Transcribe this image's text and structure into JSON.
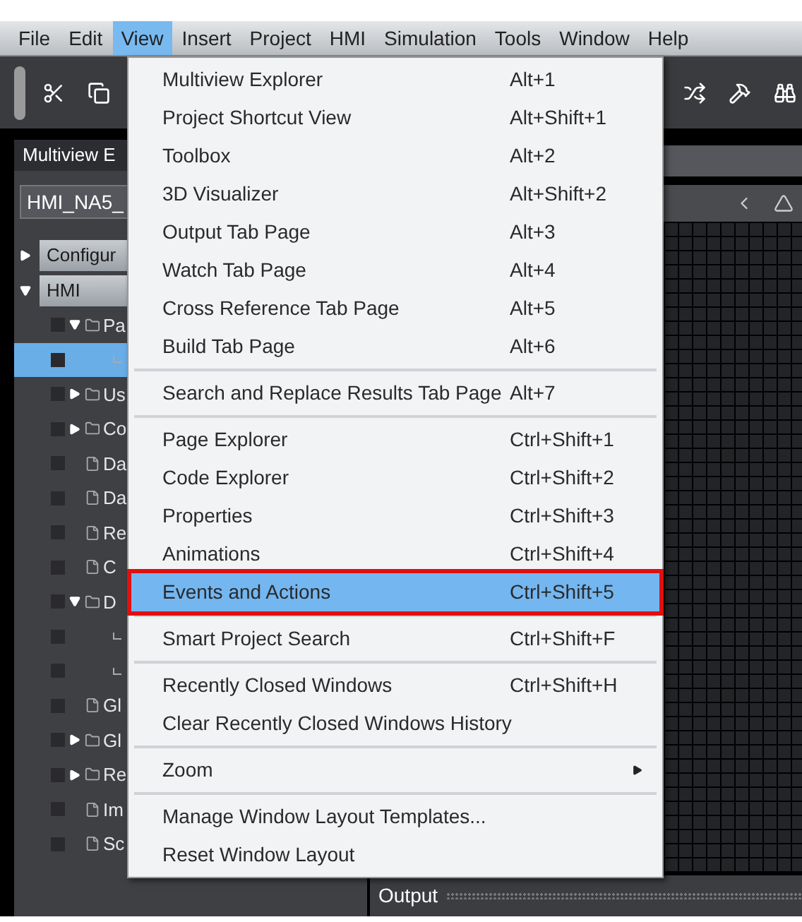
{
  "menu_bar": [
    {
      "label": "File",
      "selected": false
    },
    {
      "label": "Edit",
      "selected": false
    },
    {
      "label": "View",
      "selected": true
    },
    {
      "label": "Insert",
      "selected": false
    },
    {
      "label": "Project",
      "selected": false
    },
    {
      "label": "HMI",
      "selected": false
    },
    {
      "label": "Simulation",
      "selected": false
    },
    {
      "label": "Tools",
      "selected": false
    },
    {
      "label": "Window",
      "selected": false
    },
    {
      "label": "Help",
      "selected": false
    }
  ],
  "view_menu": [
    {
      "kind": "item",
      "label": "Multiview Explorer",
      "shortcut": "Alt+1",
      "selected": false,
      "outlined": false
    },
    {
      "kind": "item",
      "label": "Project Shortcut View",
      "shortcut": "Alt+Shift+1",
      "selected": false,
      "outlined": false
    },
    {
      "kind": "item",
      "label": "Toolbox",
      "shortcut": "Alt+2",
      "selected": false,
      "outlined": false
    },
    {
      "kind": "item",
      "label": "3D Visualizer",
      "shortcut": "Alt+Shift+2",
      "selected": false,
      "outlined": false
    },
    {
      "kind": "item",
      "label": "Output Tab Page",
      "shortcut": "Alt+3",
      "selected": false,
      "outlined": false
    },
    {
      "kind": "item",
      "label": "Watch Tab Page",
      "shortcut": "Alt+4",
      "selected": false,
      "outlined": false
    },
    {
      "kind": "item",
      "label": "Cross Reference Tab Page",
      "shortcut": "Alt+5",
      "selected": false,
      "outlined": false
    },
    {
      "kind": "item",
      "label": "Build Tab Page",
      "shortcut": "Alt+6",
      "selected": false,
      "outlined": false
    },
    {
      "kind": "separator"
    },
    {
      "kind": "item",
      "label": "Search and Replace Results Tab Page",
      "shortcut": "Alt+7",
      "selected": false,
      "outlined": false
    },
    {
      "kind": "separator"
    },
    {
      "kind": "item",
      "label": "Page Explorer",
      "shortcut": "Ctrl+Shift+1",
      "selected": false,
      "outlined": false
    },
    {
      "kind": "item",
      "label": "Code Explorer",
      "shortcut": "Ctrl+Shift+2",
      "selected": false,
      "outlined": false
    },
    {
      "kind": "item",
      "label": "Properties",
      "shortcut": "Ctrl+Shift+3",
      "selected": false,
      "outlined": false
    },
    {
      "kind": "item",
      "label": "Animations",
      "shortcut": "Ctrl+Shift+4",
      "selected": false,
      "outlined": false
    },
    {
      "kind": "item",
      "label": "Events and Actions",
      "shortcut": "Ctrl+Shift+5",
      "selected": true,
      "outlined": true
    },
    {
      "kind": "separator"
    },
    {
      "kind": "item",
      "label": "Smart Project Search",
      "shortcut": "Ctrl+Shift+F",
      "selected": false,
      "outlined": false
    },
    {
      "kind": "separator"
    },
    {
      "kind": "item",
      "label": "Recently Closed Windows",
      "shortcut": "Ctrl+Shift+H",
      "selected": false,
      "outlined": false
    },
    {
      "kind": "item",
      "label": "Clear Recently Closed Windows History",
      "selected": false,
      "outlined": false
    },
    {
      "kind": "separator"
    },
    {
      "kind": "submenu",
      "label": "Zoom",
      "selected": false,
      "outlined": false
    },
    {
      "kind": "separator"
    },
    {
      "kind": "item",
      "label": "Manage Window Layout Templates...",
      "selected": false,
      "outlined": false
    },
    {
      "kind": "item",
      "label": "Reset Window Layout",
      "selected": false,
      "outlined": false
    }
  ],
  "multiview_explorer": {
    "title": "Multiview E",
    "device": "HMI_NA5_",
    "tree": [
      {
        "kind": "section",
        "label": "Configur",
        "expanded": false,
        "selected": false
      },
      {
        "kind": "section",
        "label": "HMI",
        "expanded": true,
        "selected": false,
        "children": [
          {
            "kind": "folder",
            "label": "Pa",
            "expanded": true,
            "selected": false,
            "children": [
              {
                "kind": "branch",
                "selected": true
              }
            ]
          },
          {
            "kind": "folder",
            "label": "Us",
            "expanded": false,
            "selected": false
          },
          {
            "kind": "folder",
            "label": "Co",
            "expanded": false,
            "selected": false
          },
          {
            "kind": "leaf",
            "label": "Da",
            "selected": false
          },
          {
            "kind": "leaf",
            "label": "Da",
            "selected": false
          },
          {
            "kind": "leaf",
            "label": "Re",
            "selected": false
          },
          {
            "kind": "leaf",
            "label": "C",
            "selected": false
          },
          {
            "kind": "folder",
            "label": "D",
            "expanded": true,
            "selected": false,
            "children": [
              {
                "kind": "branch",
                "selected": false
              },
              {
                "kind": "branch",
                "selected": false
              }
            ]
          },
          {
            "kind": "leaf",
            "label": "Gl",
            "selected": false
          },
          {
            "kind": "folder",
            "label": "Gl",
            "expanded": false,
            "selected": false
          },
          {
            "kind": "folder",
            "label": "Re",
            "expanded": false,
            "selected": false
          },
          {
            "kind": "leaf",
            "label": "Im",
            "selected": false
          },
          {
            "kind": "leaf",
            "label": "Sc",
            "selected": false
          }
        ]
      }
    ]
  },
  "output_panel": {
    "title": "Output"
  }
}
